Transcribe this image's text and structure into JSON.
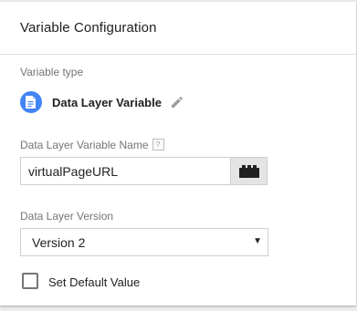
{
  "card": {
    "title": "Variable Configuration"
  },
  "variable_type": {
    "label": "Variable type",
    "name": "Data Layer Variable",
    "icon": "document-icon",
    "edit_icon": "pencil-icon",
    "icon_color": "#4285f4"
  },
  "dlv_name": {
    "label": "Data Layer Variable Name",
    "help_glyph": "?",
    "value": "virtualPageURL",
    "picker_icon": "lego-brick-icon"
  },
  "dlv_version": {
    "label": "Data Layer Version",
    "selected": "Version 2",
    "arrow_glyph": "▼"
  },
  "default_value": {
    "label": "Set Default Value",
    "checked": false
  }
}
